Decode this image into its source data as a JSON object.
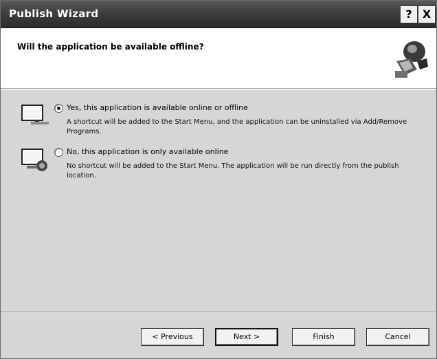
{
  "window": {
    "title": "Publish Wizard",
    "help_label": "?",
    "close_label": "X"
  },
  "header": {
    "question": "Will the application be available offline?"
  },
  "options": [
    {
      "label": "Yes, this application is available online or offline",
      "description": "A shortcut will be added to the Start Menu, and the application can be uninstalled via Add/Remove Programs.",
      "selected": true
    },
    {
      "label": "No, this application is only available online",
      "description": "No shortcut will be added to the Start Menu. The application will be run directly from the publish location.",
      "selected": false
    }
  ],
  "buttons": {
    "previous": "< Previous",
    "next": "Next >",
    "finish": "Finish",
    "cancel": "Cancel"
  },
  "icons": {
    "wizard_graphic": "wizard-graphic-icon",
    "option_offline": "computer-offline-icon",
    "option_online": "computer-online-icon"
  }
}
